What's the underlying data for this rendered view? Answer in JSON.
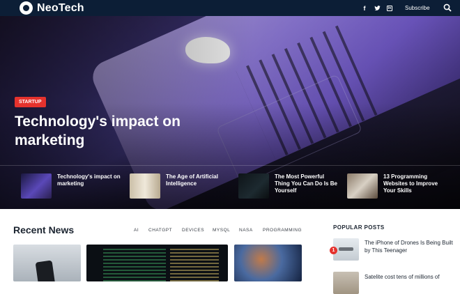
{
  "brand": {
    "name": "NeoTech"
  },
  "header": {
    "social": [
      "f",
      "t",
      "in"
    ],
    "subscribe_label": "Subscribe"
  },
  "hero": {
    "category": "STARTUP",
    "title": "Technology's impact on marketing",
    "list": [
      {
        "title": "Technology's impact on marketing"
      },
      {
        "title": "The Age of Artificial Intelligence"
      },
      {
        "title": "The Most Powerful Thing You Can Do Is Be Yourself"
      },
      {
        "title": "13 Programming Websites to Improve Your Skills"
      }
    ]
  },
  "recent": {
    "title": "Recent News",
    "tags": [
      "AI",
      "CHATGPT",
      "DEVICES",
      "MYSQL",
      "NASA",
      "PROGRAMMING"
    ]
  },
  "popular": {
    "title": "POPULAR POSTS",
    "items": [
      {
        "rank": "1",
        "title": "The iPhone of Drones Is Being Built by This Teenager"
      },
      {
        "title": "Satelite cost tens of millions of"
      }
    ]
  },
  "colors": {
    "header_bg": "#0c1e36",
    "accent": "#e5322d"
  },
  "icons": [
    "github-logo-icon",
    "facebook-icon",
    "twitter-icon",
    "linkedin-icon",
    "search-icon"
  ]
}
